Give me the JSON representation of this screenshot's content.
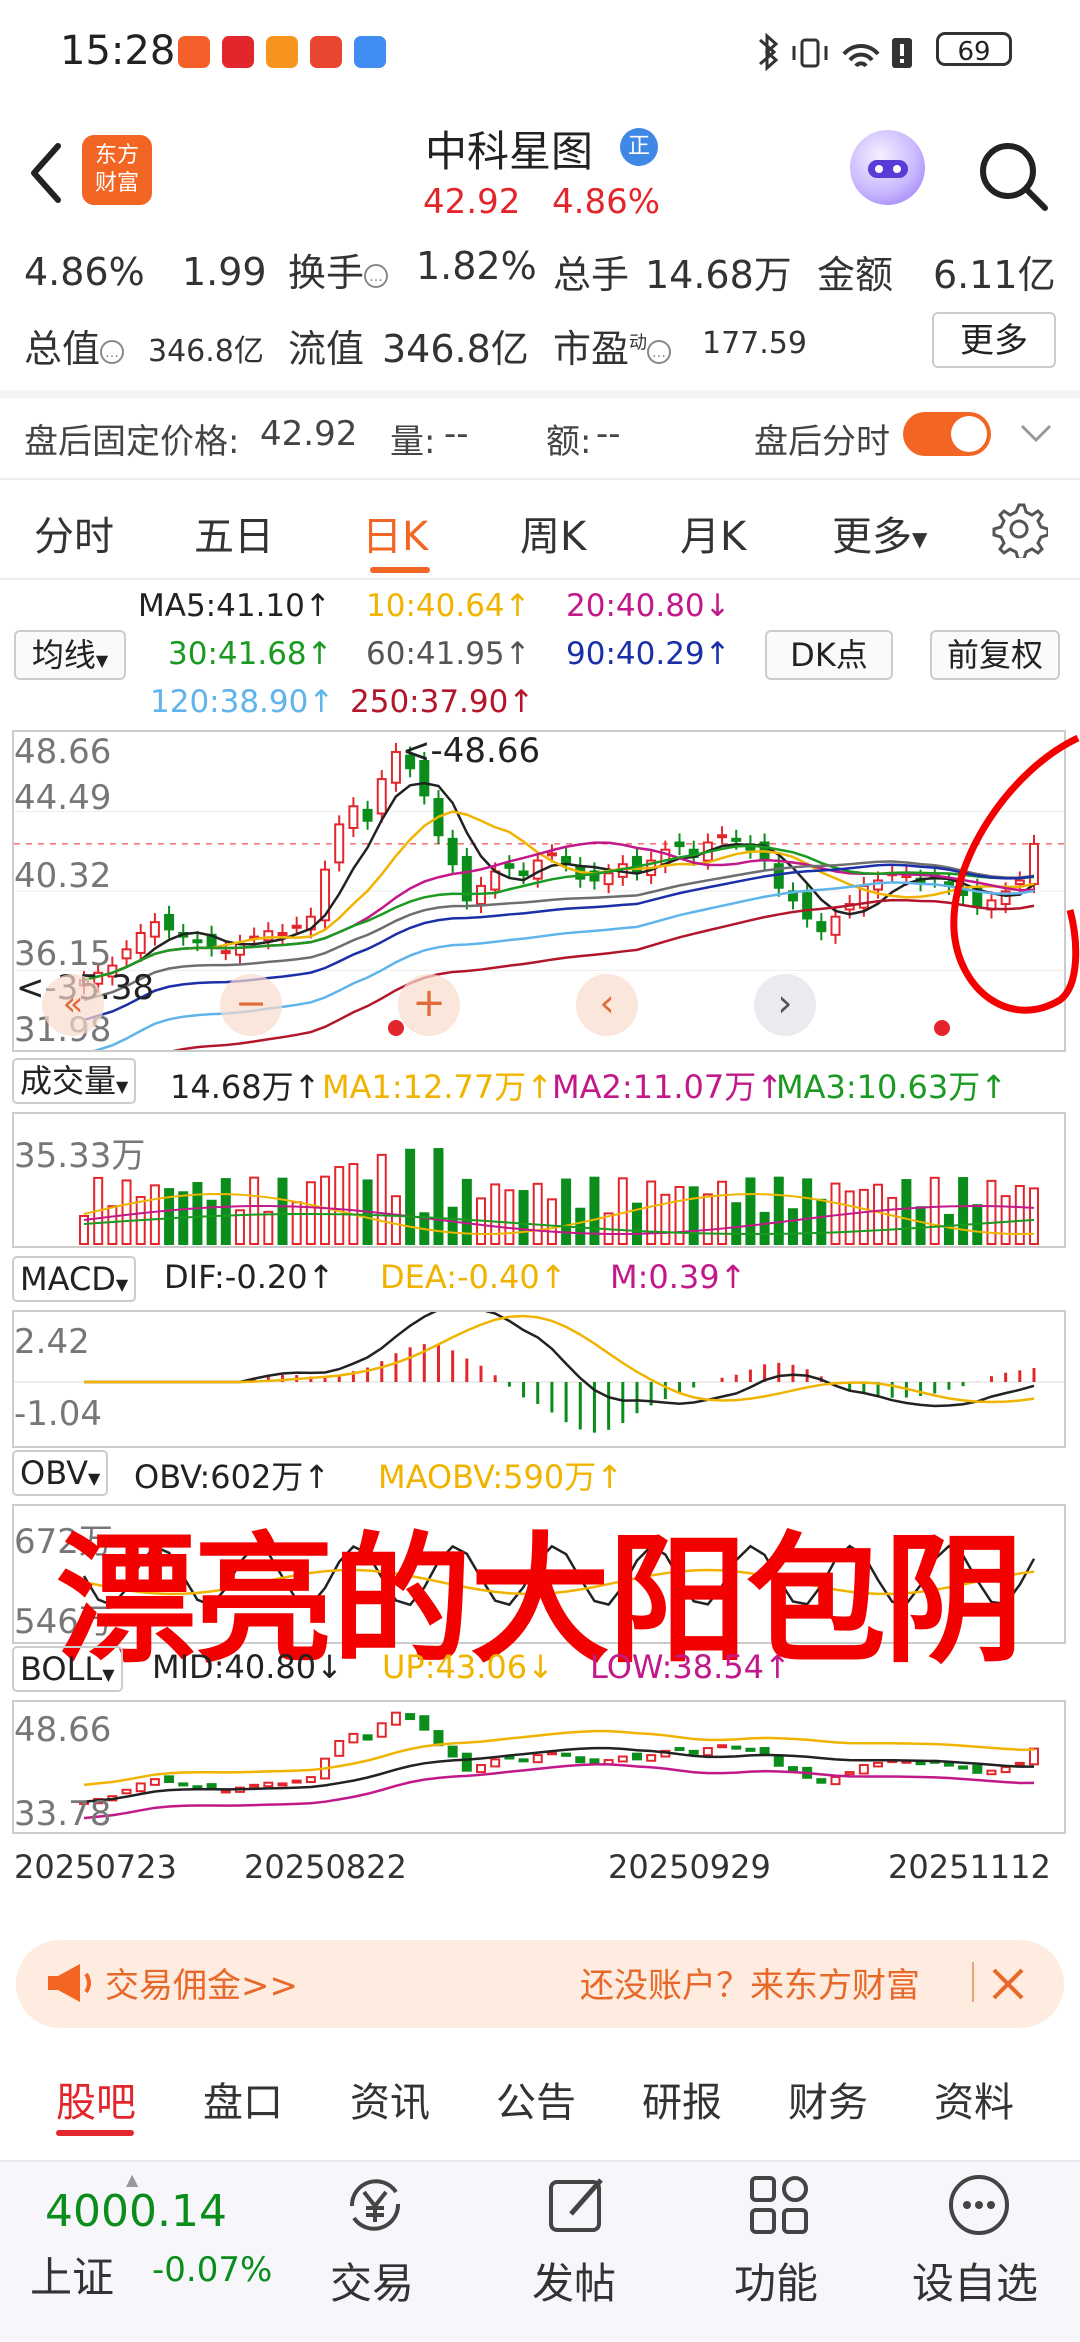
{
  "status_bar": {
    "time": "15:28",
    "battery": "69"
  },
  "header": {
    "logo_text": "东方\n财富",
    "stock_name": "中科星图",
    "badge": "正",
    "price": "42.92",
    "change_pct": "4.86%"
  },
  "quote": {
    "change_pct": "4.86%",
    "change_amt": "1.99",
    "turnover_label": "换手",
    "turnover_value": "1.82%",
    "volume_label": "总手",
    "volume_value": "14.68万",
    "amount_label": "金额",
    "amount_value": "6.11亿",
    "mktcap_label": "总值",
    "mktcap_value": "346.8亿",
    "float_label": "流值",
    "float_value": "346.8亿",
    "pe_label": "市盈",
    "pe_super": "动",
    "pe_value": "177.59",
    "more_label": "更多"
  },
  "after_hours": {
    "price_label": "盘后固定价格:",
    "price_value": "42.92",
    "vol_label": "量:",
    "vol_value": "--",
    "amt_label": "额:",
    "amt_value": "--",
    "intraday_label": "盘后分时"
  },
  "chart_tabs": [
    "分时",
    "五日",
    "日K",
    "周K",
    "月K",
    "更多"
  ],
  "ma_legend": {
    "selector": "均线",
    "ma5": "MA5:41.10↑",
    "ma10": "10:40.64↑",
    "ma20": "20:40.80↓",
    "ma30": "30:41.68↑",
    "ma60": "60:41.95↑",
    "ma90": "90:40.29↑",
    "ma120": "120:38.90↑",
    "ma250": "250:37.90↑",
    "dk_button": "DK点",
    "adjust_button": "前复权"
  },
  "colors": {
    "up": "#e3262c",
    "down": "#0a8d1a",
    "ma5": "#222222",
    "ma10": "#f0b400",
    "ma20": "#c2188a",
    "ma30": "#1a9a20",
    "ma60": "#6e6e6e",
    "ma90": "#1b2fa8",
    "ma120": "#5fb4ec",
    "ma250": "#b3162a",
    "accent": "#f26522"
  },
  "price_chart": {
    "y_labels": [
      "48.66",
      "44.49",
      "40.32",
      "36.15",
      "31.98"
    ],
    "high_marker": "<-48.66",
    "low_marker": "<-35.38"
  },
  "volume": {
    "selector": "成交量",
    "vol": "14.68万↑",
    "ma1": "MA1:12.77万↑",
    "ma2": "MA2:11.07万↑",
    "ma3": "MA3:10.63万↑",
    "y_label": "35.33万"
  },
  "macd": {
    "selector": "MACD",
    "dif": "DIF:-0.20↑",
    "dea": "DEA:-0.40↑",
    "m": "M:0.39↑",
    "y_top": "2.42",
    "y_bottom": "-1.04"
  },
  "obv": {
    "selector": "OBV",
    "obv": "OBV:602万↑",
    "maobv": "MAOBV:590万↑",
    "y_top": "672万",
    "y_bottom": "546万"
  },
  "boll": {
    "selector": "BOLL",
    "mid": "MID:40.80↓",
    "up": "UP:43.06↓",
    "low": "LOW:38.54↑",
    "y_top": "48.66",
    "y_bottom": "33.78"
  },
  "dates": [
    "20250723",
    "20250822",
    "20250929",
    "20251112"
  ],
  "annotation_text": "漂亮的大阳包阴",
  "promo": {
    "left": "交易佣金>>",
    "right": "还没账户？来东方财富"
  },
  "bottom_tabs": [
    "股吧",
    "盘口",
    "资讯",
    "公告",
    "研报",
    "财务",
    "资料"
  ],
  "bottom_bar": {
    "index_value": "4000.14",
    "index_name": "上证",
    "index_pct": "-0.07%",
    "trade": "交易",
    "post": "发帖",
    "functions": "功能",
    "watchlist": "设自选"
  },
  "chart_data": {
    "type": "candlestick",
    "title": "中科星图 日K",
    "x_labels": [
      "20250723",
      "20250822",
      "20250929",
      "20251112"
    ],
    "ylim": [
      31.98,
      48.66
    ],
    "series": [
      {
        "name": "K",
        "values": [
          35.4,
          35.8,
          36.2,
          37.1,
          38.0,
          38.6,
          38.2,
          37.8,
          37.5,
          37.2,
          37.0,
          37.4,
          37.8,
          38.1,
          38.0,
          38.4,
          38.9,
          41.5,
          44.0,
          45.0,
          44.2,
          46.5,
          48.0,
          47.1,
          45.6,
          43.4,
          41.8,
          39.8,
          40.6,
          41.4,
          41.6,
          41.2,
          42.0,
          42.4,
          41.9,
          41.0,
          40.9,
          41.3,
          41.8,
          41.4,
          42.0,
          42.6,
          42.8,
          42.2,
          43.0,
          43.4,
          43.1,
          42.6,
          42.0,
          40.5,
          39.8,
          38.8,
          38.1,
          38.9,
          39.6,
          40.6,
          40.9,
          41.3,
          41.2,
          40.8,
          41.0,
          40.6,
          40.1,
          39.5,
          39.8,
          40.3,
          40.9,
          42.92
        ]
      },
      {
        "name": "MA5",
        "values": [
          41.1
        ]
      },
      {
        "name": "MA10",
        "values": [
          40.64
        ]
      },
      {
        "name": "MA20",
        "values": [
          40.8
        ]
      },
      {
        "name": "MA30",
        "values": [
          41.68
        ]
      },
      {
        "name": "MA60",
        "values": [
          41.95
        ]
      },
      {
        "name": "MA90",
        "values": [
          40.29
        ]
      },
      {
        "name": "MA120",
        "values": [
          38.9
        ]
      },
      {
        "name": "MA250",
        "values": [
          37.9
        ]
      }
    ]
  }
}
